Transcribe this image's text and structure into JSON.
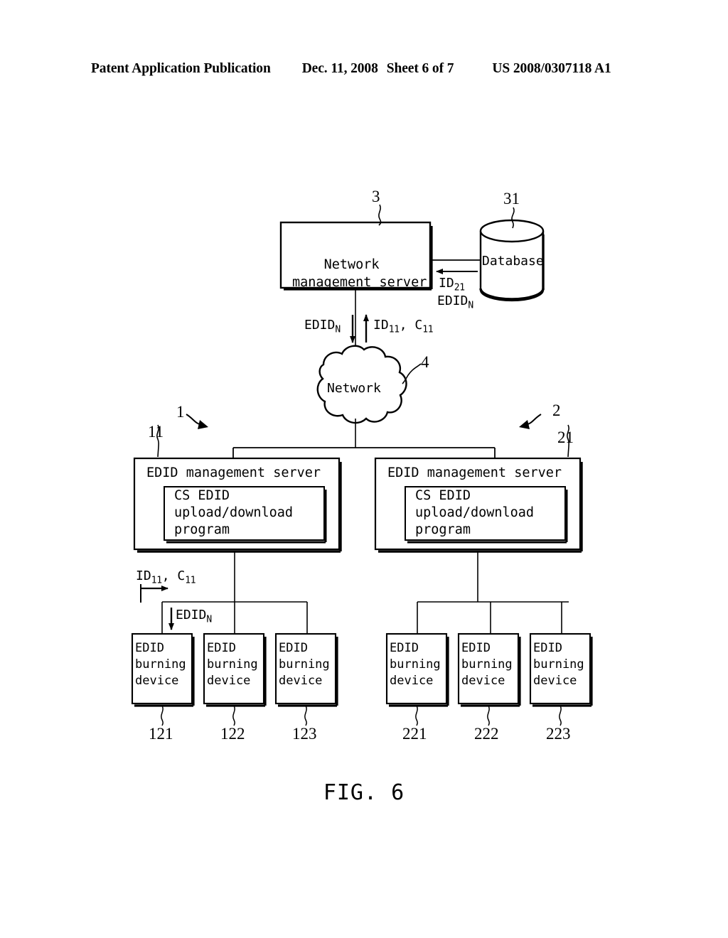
{
  "header": {
    "publication": "Patent Application Publication",
    "date": "Dec. 11, 2008",
    "sheet": "Sheet 6 of 7",
    "patent_number": "US 2008/0307118 A1"
  },
  "figure": {
    "caption": "FIG. 6",
    "nodes": {
      "network_management_server": "Network\nmanagement server",
      "database": "Database",
      "network_cloud": "Network",
      "edid_management_server_left": "EDID management server",
      "edid_management_server_right": "EDID management server",
      "cs_program_left": "CS EDID\nupload/download\nprogram",
      "cs_program_right": "CS EDID\nupload/download\nprogram",
      "burning_device": "EDID\nburning\ndevice"
    },
    "flow_labels": {
      "db_to_nms_line1": "ID",
      "db_to_nms_line1_sub": "21",
      "db_to_nms_line2": "EDID",
      "db_to_nms_line2_sub": "N",
      "nms_down": "EDID",
      "nms_down_sub": "N",
      "nms_up": "ID",
      "nms_up_sub1": "11",
      "nms_up_mid": ", C",
      "nms_up_sub2": "11",
      "server_out": "ID",
      "server_out_sub1": "11",
      "server_out_mid": ", C",
      "server_out_sub2": "11",
      "device_in": "EDID",
      "device_in_sub": "N"
    },
    "reference_numerals": {
      "nms": "3",
      "database": "31",
      "network": "4",
      "system_left": "1",
      "system_right": "2",
      "edid_server_left": "11",
      "edid_server_right": "21",
      "device_121": "121",
      "device_122": "122",
      "device_123": "123",
      "device_221": "221",
      "device_222": "222",
      "device_223": "223"
    }
  },
  "colors": {
    "ink": "#000000",
    "paper": "#ffffff"
  }
}
